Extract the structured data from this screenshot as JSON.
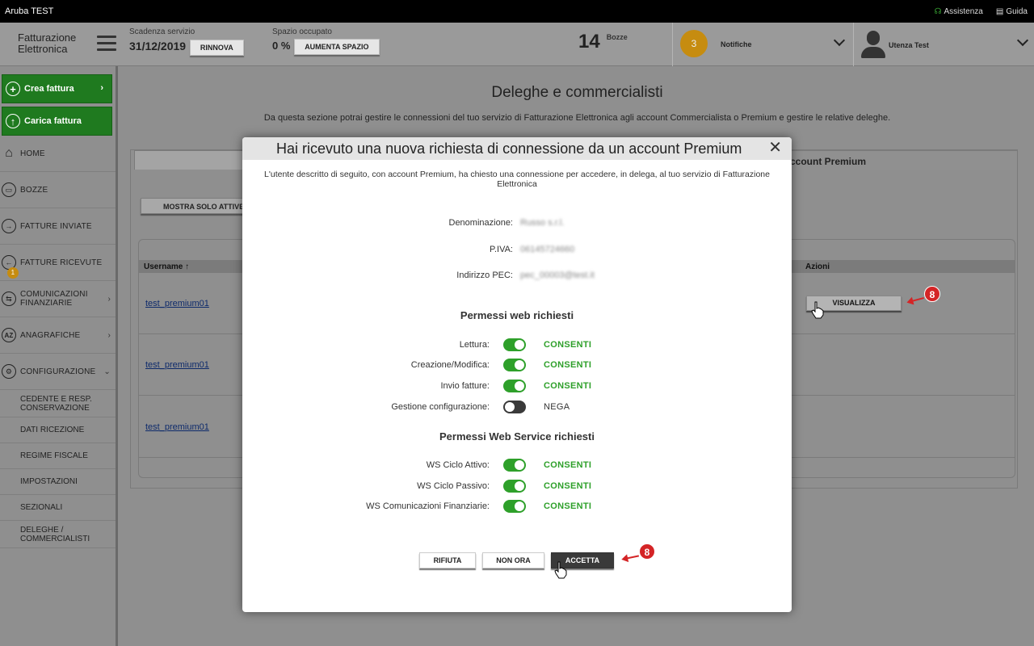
{
  "topbar": {
    "title": "Aruba TEST",
    "assistance": "Assistenza",
    "guide": "Guida"
  },
  "header": {
    "logo_line1": "Fatturazione",
    "logo_line2": "Elettronica",
    "service_expiry_label": "Scadenza servizio",
    "service_expiry_value": "31/12/2019",
    "renew_button": "RINNOVA",
    "space_label": "Spazio occupato",
    "space_value": "0 %",
    "increase_space_button": "AUMENTA SPAZIO",
    "drafts_count": "14",
    "drafts_label": "Bozze",
    "notifications_count": "3",
    "notifications_label": "Notifiche",
    "user_label": "Utenza Test"
  },
  "sidebar": {
    "create_invoice": "Crea fattura",
    "upload_invoice": "Carica fattura",
    "items": [
      {
        "label": "HOME"
      },
      {
        "label": "BOZZE"
      },
      {
        "label": "FATTURE INVIATE"
      },
      {
        "label": "FATTURE RICEVUTE",
        "badge": "1"
      },
      {
        "label": "COMUNICAZIONI FINANZIARIE"
      },
      {
        "label": "ANAGRAFICHE"
      },
      {
        "label": "CONFIGURAZIONE"
      }
    ],
    "sub_items": [
      {
        "label": "CEDENTE E RESP. CONSERVAZIONE"
      },
      {
        "label": "DATI RICEZIONE"
      },
      {
        "label": "REGIME FISCALE"
      },
      {
        "label": "IMPOSTAZIONI"
      },
      {
        "label": "SEZIONALI"
      },
      {
        "label": "DELEGHE / COMMERCIALISTI"
      }
    ]
  },
  "main": {
    "title": "Deleghe e commercialisti",
    "description": "Da questa sezione potrai gestire le connessioni del tuo servizio di Fatturazione Elettronica agli account Commercialista o Premium e gestire le relative deleghe.",
    "tab_right_label": "ccount Premium",
    "show_active_button": "MOSTRA SOLO ATTIVE",
    "table": {
      "col_username": "Username ↑",
      "col_actions": "Azioni",
      "rows": [
        {
          "username": "test_premium01",
          "action": "VISUALIZZA"
        },
        {
          "username": "test_premium01"
        },
        {
          "username": "test_premium01"
        }
      ]
    }
  },
  "annotations": {
    "marker_visualizza": "8",
    "marker_accept": "8"
  },
  "modal": {
    "title": "Hai ricevuto una nuova richiesta di connessione da un account Premium",
    "intro": "L'utente descritto di seguito, con account Premium, ha chiesto una connessione per accedere, in delega, al tuo servizio di Fatturazione Elettronica",
    "fields": [
      {
        "label": "Denominazione:",
        "value": "Russo s.r.l."
      },
      {
        "label": "P.IVA:",
        "value": "06145724660"
      },
      {
        "label": "Indirizzo PEC:",
        "value": "pec_00003@test.it"
      }
    ],
    "web_section_title": "Permessi web richiesti",
    "web_permissions": [
      {
        "label": "Lettura:",
        "state": "CONSENTI",
        "on": true
      },
      {
        "label": "Creazione/Modifica:",
        "state": "CONSENTI",
        "on": true
      },
      {
        "label": "Invio fatture:",
        "state": "CONSENTI",
        "on": true
      },
      {
        "label": "Gestione configurazione:",
        "state": "NEGA",
        "on": false
      }
    ],
    "ws_section_title": "Permessi Web Service richiesti",
    "ws_permissions": [
      {
        "label": "WS Ciclo Attivo:",
        "state": "CONSENTI",
        "on": true
      },
      {
        "label": "WS Ciclo Passivo:",
        "state": "CONSENTI",
        "on": true
      },
      {
        "label": "WS Comunicazioni Finanziarie:",
        "state": "CONSENTI",
        "on": true
      }
    ],
    "reject_button": "RIFIUTA",
    "not_now_button": "NON ORA",
    "accept_button": "ACCETTA"
  },
  "colors": {
    "accent_green": "#2ea02a",
    "sidebar_green": "#1f7a1f",
    "badge_orange": "#c68c10",
    "annotation_red": "#d42426"
  }
}
